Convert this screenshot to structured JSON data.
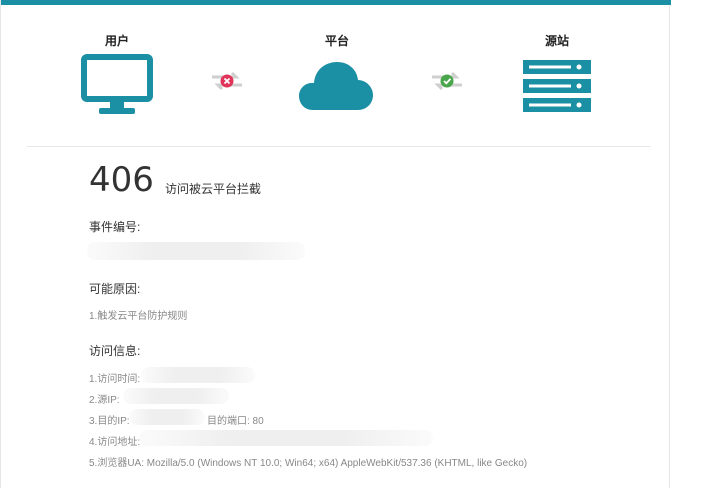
{
  "flow": {
    "user_label": "用户",
    "platform_label": "平台",
    "origin_label": "源站",
    "link1_status": "blocked",
    "link2_status": "ok",
    "icon_color": "#1b8fa3"
  },
  "error": {
    "code": "406",
    "description": "访问被云平台拦截"
  },
  "event": {
    "title": "事件编号:"
  },
  "reason": {
    "title": "可能原因:",
    "item1": "1.触发云平台防护规则"
  },
  "access": {
    "title": "访问信息:",
    "time_label": "1.访问时间:",
    "src_ip_label": "2.源IP:",
    "dst_ip_label": "3.目的IP:",
    "dst_port": "目的端口: 80",
    "url_label": "4.访问地址:",
    "ua_text": "5.浏览器UA: Mozilla/5.0 (Windows NT 10.0; Win64; x64) AppleWebKit/537.36 (KHTML, like Gecko)"
  }
}
